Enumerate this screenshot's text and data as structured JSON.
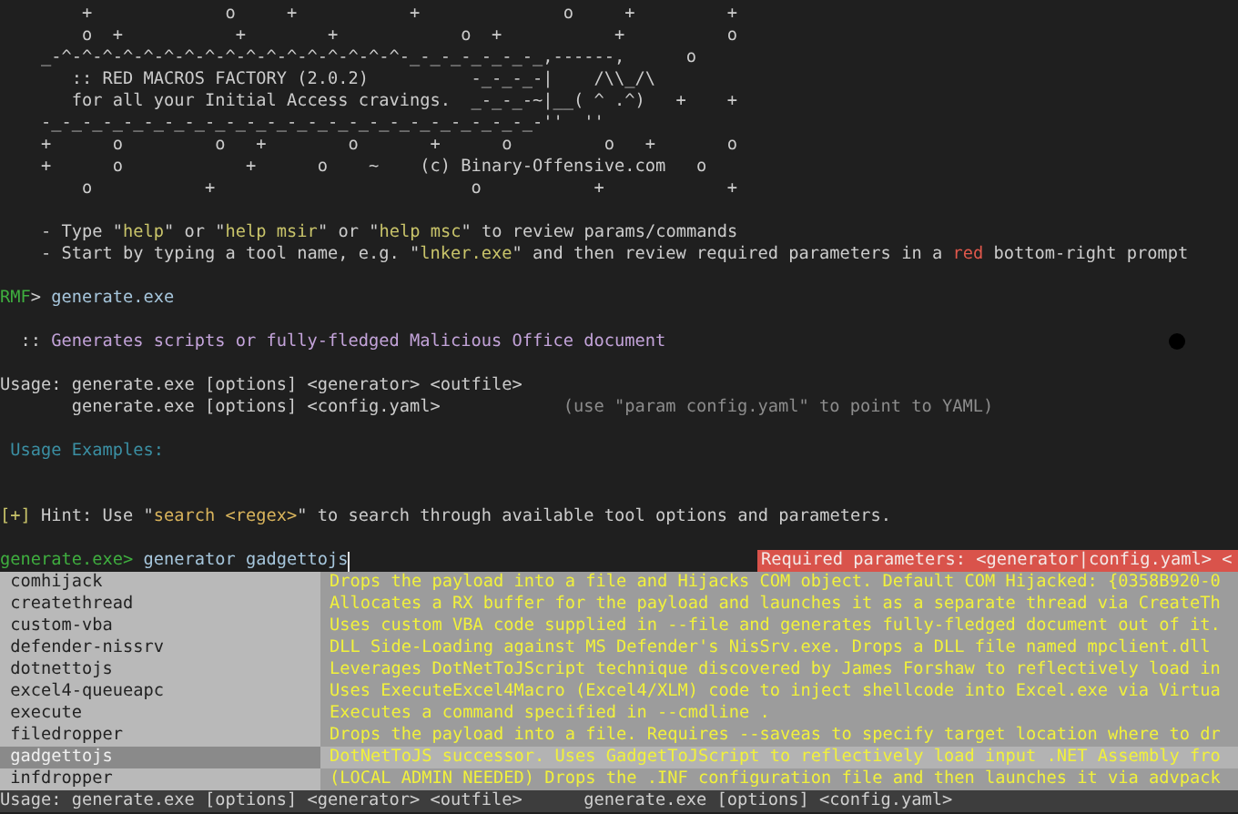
{
  "banner": [
    "        +             o     +           +              o     +         +",
    "        o  +           +        +            o  +           +          o",
    "    _-^-^-^-^-^-^-^-^-^-^-^-^-^-^-^-^-^-_-_-_-_-_-_-_,------,      o",
    "       :: RED MACROS FACTORY (2.0.2)          -_-_-_-|    /\\\\_/\\",
    "       for all your Initial Access cravings.  _-_-_-~|__( ^ .^)   +    +",
    "    -_-_-_-_-_-_-_-_-_-_-_-_-_-_-_-_-_-_-_-_-_-_-_-_-''  ''",
    "    +      o         o   +        o       +      o         o   +       o",
    "    +      o            +      o    ~    (c) Binary-Offensive.com   o",
    "        o           +                         o           +            +"
  ],
  "tips": [
    [
      {
        "kind": "plain",
        "text": "    - Type \""
      },
      {
        "kind": "quoted",
        "text": "help"
      },
      {
        "kind": "plain",
        "text": "\" or \""
      },
      {
        "kind": "quoted",
        "text": "help msir"
      },
      {
        "kind": "plain",
        "text": "\" or \""
      },
      {
        "kind": "quoted",
        "text": "help msc"
      },
      {
        "kind": "plain",
        "text": "\" to review params/commands"
      }
    ],
    [
      {
        "kind": "plain",
        "text": "    - Start by typing a tool name, e.g. \""
      },
      {
        "kind": "quoted",
        "text": "lnker.exe"
      },
      {
        "kind": "plain",
        "text": "\" and then review required parameters in a "
      },
      {
        "kind": "emphasis",
        "text": "red"
      },
      {
        "kind": "plain",
        "text": " bottom-right prompt"
      }
    ]
  ],
  "command": {
    "prompt": "RMF",
    "arrow": ">",
    "text": "generate.exe"
  },
  "description": [
    {
      "kind": "plain",
      "text": "  :: "
    },
    {
      "kind": "summary",
      "text": "Generates scripts or fully-fledged Malicious Office document"
    }
  ],
  "usage": [
    [
      {
        "kind": "plain",
        "text": "Usage: generate.exe [options] <generator> <outfile>"
      }
    ],
    [
      {
        "kind": "plain",
        "text": "       generate.exe [options] <config.yaml>"
      },
      {
        "kind": "muted",
        "text": "            (use \"param config.yaml\" to point to YAML)"
      }
    ]
  ],
  "examples_heading": "Usage Examples:",
  "hint": [
    {
      "kind": "marker",
      "text": "[+]"
    },
    {
      "kind": "plain",
      "text": " Hint: Use \""
    },
    {
      "kind": "search",
      "text": "search <regex>"
    },
    {
      "kind": "plain",
      "text": "\" to search through available tool options and parameters."
    }
  ],
  "input": {
    "prompt": "generate.exe>",
    "value": " generator gadgettojs"
  },
  "required_prompt": "Required parameters: <generator|config.yaml> <",
  "completions": [
    {
      "name": "comhijack",
      "description": "Drops the payload into a file and Hijacks COM object. Default COM Hijacked: {0358B920-0",
      "selected": false
    },
    {
      "name": "createthread",
      "description": "Allocates a RX buffer for the payload and launches it as a separate thread via CreateTh",
      "selected": false
    },
    {
      "name": "custom-vba",
      "description": "Uses custom VBA code supplied in --file and generates fully-fledged document out of it.",
      "selected": false
    },
    {
      "name": "defender-nissrv",
      "description": "DLL Side-Loading against MS Defender's NisSrv.exe. Drops a DLL file named mpclient.dll",
      "selected": false
    },
    {
      "name": "dotnettojs",
      "description": "Leverages DotNetToJScript technique discovered by James Forshaw to reflectively load in",
      "selected": false
    },
    {
      "name": "excel4-queueapc",
      "description": "Uses ExecuteExcel4Macro (Excel4/XLM) code to inject shellcode into Excel.exe via Virtua",
      "selected": false
    },
    {
      "name": "execute",
      "description": "Executes a command specified in --cmdline .",
      "selected": false
    },
    {
      "name": "filedropper",
      "description": "Drops the payload into a file. Requires --saveas to specify target location where to dr",
      "selected": false
    },
    {
      "name": "gadgettojs",
      "description": "DotNetToJS successor. Uses GadgetToJScript to reflectively load input .NET Assembly fro",
      "selected": true
    },
    {
      "name": "infdropper",
      "description": "(LOCAL ADMIN NEEDED) Drops the .INF configuration file and then launches it via advpack",
      "selected": false
    }
  ],
  "status_bar": "Usage: generate.exe [options] <generator> <outfile>      generate.exe [options] <config.yaml>"
}
